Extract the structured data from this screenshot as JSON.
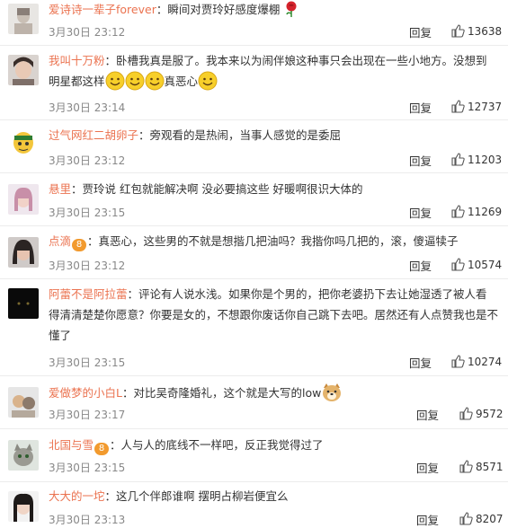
{
  "comments": [
    {
      "user": "爱诗诗一辈子forever",
      "text": "瞬间对贾玲好感度爆棚",
      "time": "3月30日 23:12",
      "reply": "回复",
      "likes": "13638"
    },
    {
      "user": "我叫十万粉",
      "text": "卧槽我真是服了。我本来以为闹伴娘这种事只会出现在一些小地方。没想到明星都这样",
      "text_end": "真恶心",
      "time": "3月30日 23:14",
      "reply": "回复",
      "likes": "12737"
    },
    {
      "user": "过气网红二胡卵子",
      "text": "旁观看的是热闹，当事人感觉的是委屈",
      "time": "3月30日 23:12",
      "reply": "回复",
      "likes": "11203"
    },
    {
      "user": "悬里",
      "text": "贾玲说 红包就能解决啊 没必要搞这些 好暖啊很识大体的",
      "time": "3月30日 23:15",
      "reply": "回复",
      "likes": "11269"
    },
    {
      "user": "点滴",
      "badge": "8",
      "text": "真恶心，这些男的不就是想揩几把油吗？我揩你吗几把的，滚，傻逼犊子",
      "time": "3月30日 23:12",
      "reply": "回复",
      "likes": "10574"
    },
    {
      "user": "阿蕾不是阿拉蕾",
      "text": "评论有人说水浅。如果你是个男的，把你老婆扔下去让她湿透了被人看得清清楚楚你愿意？你要是女的，不想跟你废话你自己跳下去吧。居然还有人点赞我也是不懂了",
      "time": "3月30日 23:15",
      "reply": "回复",
      "likes": "10274"
    },
    {
      "user": "爱做梦的小白L",
      "text": "对比吴奇隆婚礼，这个就是大写的low",
      "time": "3月30日 23:17",
      "reply": "回复",
      "likes": "9572"
    },
    {
      "user": "北国与雪",
      "badge": "8",
      "text": "人与人的底线不一样吧，反正我觉得过了",
      "time": "3月30日 23:15",
      "reply": "回复",
      "likes": "8571"
    },
    {
      "user": "大大的一坨",
      "text": "这几个伴郎谁啊 摆明占柳岩便宜么",
      "time": "3月30日 23:13",
      "reply": "回复",
      "likes": "8207"
    }
  ],
  "icons": {
    "like": "thumbs-up-icon",
    "smile": "smile-emoji-icon",
    "rose": "rose-emoji-icon",
    "dog": "doge-emoji-icon"
  }
}
